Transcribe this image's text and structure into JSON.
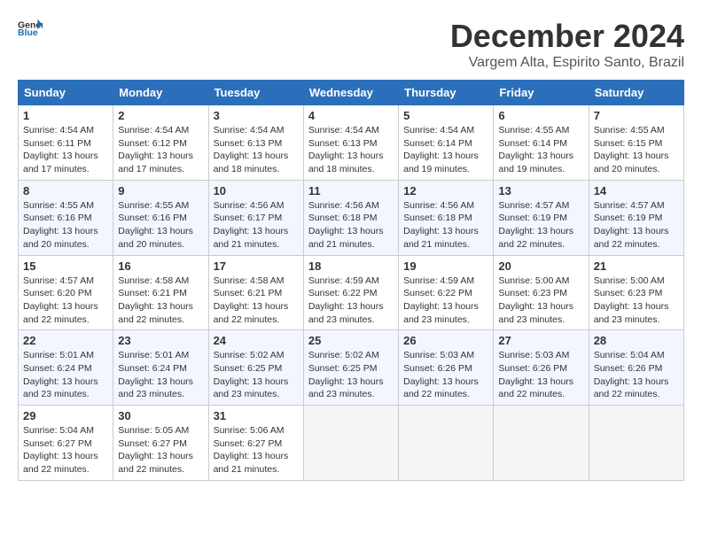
{
  "header": {
    "logo_line1": "General",
    "logo_line2": "Blue",
    "month": "December 2024",
    "location": "Vargem Alta, Espirito Santo, Brazil"
  },
  "weekdays": [
    "Sunday",
    "Monday",
    "Tuesday",
    "Wednesday",
    "Thursday",
    "Friday",
    "Saturday"
  ],
  "weeks": [
    [
      {
        "day": "1",
        "info": "Sunrise: 4:54 AM\nSunset: 6:11 PM\nDaylight: 13 hours\nand 17 minutes."
      },
      {
        "day": "2",
        "info": "Sunrise: 4:54 AM\nSunset: 6:12 PM\nDaylight: 13 hours\nand 17 minutes."
      },
      {
        "day": "3",
        "info": "Sunrise: 4:54 AM\nSunset: 6:13 PM\nDaylight: 13 hours\nand 18 minutes."
      },
      {
        "day": "4",
        "info": "Sunrise: 4:54 AM\nSunset: 6:13 PM\nDaylight: 13 hours\nand 18 minutes."
      },
      {
        "day": "5",
        "info": "Sunrise: 4:54 AM\nSunset: 6:14 PM\nDaylight: 13 hours\nand 19 minutes."
      },
      {
        "day": "6",
        "info": "Sunrise: 4:55 AM\nSunset: 6:14 PM\nDaylight: 13 hours\nand 19 minutes."
      },
      {
        "day": "7",
        "info": "Sunrise: 4:55 AM\nSunset: 6:15 PM\nDaylight: 13 hours\nand 20 minutes."
      }
    ],
    [
      {
        "day": "8",
        "info": "Sunrise: 4:55 AM\nSunset: 6:16 PM\nDaylight: 13 hours\nand 20 minutes."
      },
      {
        "day": "9",
        "info": "Sunrise: 4:55 AM\nSunset: 6:16 PM\nDaylight: 13 hours\nand 20 minutes."
      },
      {
        "day": "10",
        "info": "Sunrise: 4:56 AM\nSunset: 6:17 PM\nDaylight: 13 hours\nand 21 minutes."
      },
      {
        "day": "11",
        "info": "Sunrise: 4:56 AM\nSunset: 6:18 PM\nDaylight: 13 hours\nand 21 minutes."
      },
      {
        "day": "12",
        "info": "Sunrise: 4:56 AM\nSunset: 6:18 PM\nDaylight: 13 hours\nand 21 minutes."
      },
      {
        "day": "13",
        "info": "Sunrise: 4:57 AM\nSunset: 6:19 PM\nDaylight: 13 hours\nand 22 minutes."
      },
      {
        "day": "14",
        "info": "Sunrise: 4:57 AM\nSunset: 6:19 PM\nDaylight: 13 hours\nand 22 minutes."
      }
    ],
    [
      {
        "day": "15",
        "info": "Sunrise: 4:57 AM\nSunset: 6:20 PM\nDaylight: 13 hours\nand 22 minutes."
      },
      {
        "day": "16",
        "info": "Sunrise: 4:58 AM\nSunset: 6:21 PM\nDaylight: 13 hours\nand 22 minutes."
      },
      {
        "day": "17",
        "info": "Sunrise: 4:58 AM\nSunset: 6:21 PM\nDaylight: 13 hours\nand 22 minutes."
      },
      {
        "day": "18",
        "info": "Sunrise: 4:59 AM\nSunset: 6:22 PM\nDaylight: 13 hours\nand 23 minutes."
      },
      {
        "day": "19",
        "info": "Sunrise: 4:59 AM\nSunset: 6:22 PM\nDaylight: 13 hours\nand 23 minutes."
      },
      {
        "day": "20",
        "info": "Sunrise: 5:00 AM\nSunset: 6:23 PM\nDaylight: 13 hours\nand 23 minutes."
      },
      {
        "day": "21",
        "info": "Sunrise: 5:00 AM\nSunset: 6:23 PM\nDaylight: 13 hours\nand 23 minutes."
      }
    ],
    [
      {
        "day": "22",
        "info": "Sunrise: 5:01 AM\nSunset: 6:24 PM\nDaylight: 13 hours\nand 23 minutes."
      },
      {
        "day": "23",
        "info": "Sunrise: 5:01 AM\nSunset: 6:24 PM\nDaylight: 13 hours\nand 23 minutes."
      },
      {
        "day": "24",
        "info": "Sunrise: 5:02 AM\nSunset: 6:25 PM\nDaylight: 13 hours\nand 23 minutes."
      },
      {
        "day": "25",
        "info": "Sunrise: 5:02 AM\nSunset: 6:25 PM\nDaylight: 13 hours\nand 23 minutes."
      },
      {
        "day": "26",
        "info": "Sunrise: 5:03 AM\nSunset: 6:26 PM\nDaylight: 13 hours\nand 22 minutes."
      },
      {
        "day": "27",
        "info": "Sunrise: 5:03 AM\nSunset: 6:26 PM\nDaylight: 13 hours\nand 22 minutes."
      },
      {
        "day": "28",
        "info": "Sunrise: 5:04 AM\nSunset: 6:26 PM\nDaylight: 13 hours\nand 22 minutes."
      }
    ],
    [
      {
        "day": "29",
        "info": "Sunrise: 5:04 AM\nSunset: 6:27 PM\nDaylight: 13 hours\nand 22 minutes."
      },
      {
        "day": "30",
        "info": "Sunrise: 5:05 AM\nSunset: 6:27 PM\nDaylight: 13 hours\nand 22 minutes."
      },
      {
        "day": "31",
        "info": "Sunrise: 5:06 AM\nSunset: 6:27 PM\nDaylight: 13 hours\nand 21 minutes."
      },
      {
        "day": "",
        "info": ""
      },
      {
        "day": "",
        "info": ""
      },
      {
        "day": "",
        "info": ""
      },
      {
        "day": "",
        "info": ""
      }
    ]
  ]
}
